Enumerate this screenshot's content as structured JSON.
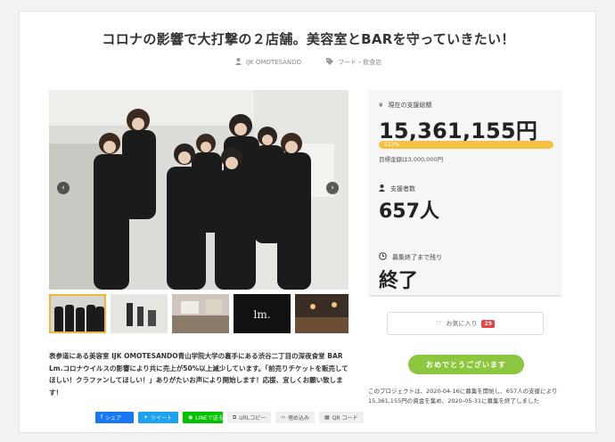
{
  "project": {
    "title": "コロナの影響で大打撃の２店舗。美容室とBARを守っていきたい！",
    "owner": "IJK OMOTESANDO",
    "category": "フード・飲食店"
  },
  "gallery": {
    "prev_icon": "chevron-left-icon",
    "next_icon": "chevron-right-icon",
    "thumb_logo_text": "lm."
  },
  "description": "表参道にある美容室 IJK OMOTESANDO青山学院大学の裏手にある渋谷二丁目の深夜食堂 BAR Lm.コロナウイルスの影響により共に売上が50%以上減少しています。「前売りチケットを販売してほしい！クラファンしてほしい！」ありがたいお声により開始します！応援、宜しくお願い致します！",
  "share": {
    "facebook": "シェア",
    "twitter": "ツイート",
    "line": "LINEで送る",
    "url_copy": "URLコピー",
    "embed": "埋め込み",
    "qr": "QR コード"
  },
  "stats": {
    "raised_label": "現在の支援総額",
    "raised_amount": "15,361,155円",
    "progress_percent": 512,
    "progress_text": "512%",
    "goal_text": "目標金額は3,000,000円",
    "backers_label": "支援者数",
    "backers_value": "657人",
    "remaining_label": "募集終了まで残り",
    "remaining_value": "終了"
  },
  "favorite": {
    "label": "お気に入り",
    "count": "29"
  },
  "congrats_label": "おめでとうございます",
  "summary": "このプロジェクトは、2020-04-16に募集を開始し、657人の支援により15,361,155円の資金を集め、2020-05-31に募集を終了しました",
  "colors": {
    "progress": "#f6c143",
    "congrats": "#8dc63f",
    "fav_badge": "#e84545",
    "facebook": "#1877f2",
    "twitter": "#1da1f2",
    "line": "#00c300"
  }
}
